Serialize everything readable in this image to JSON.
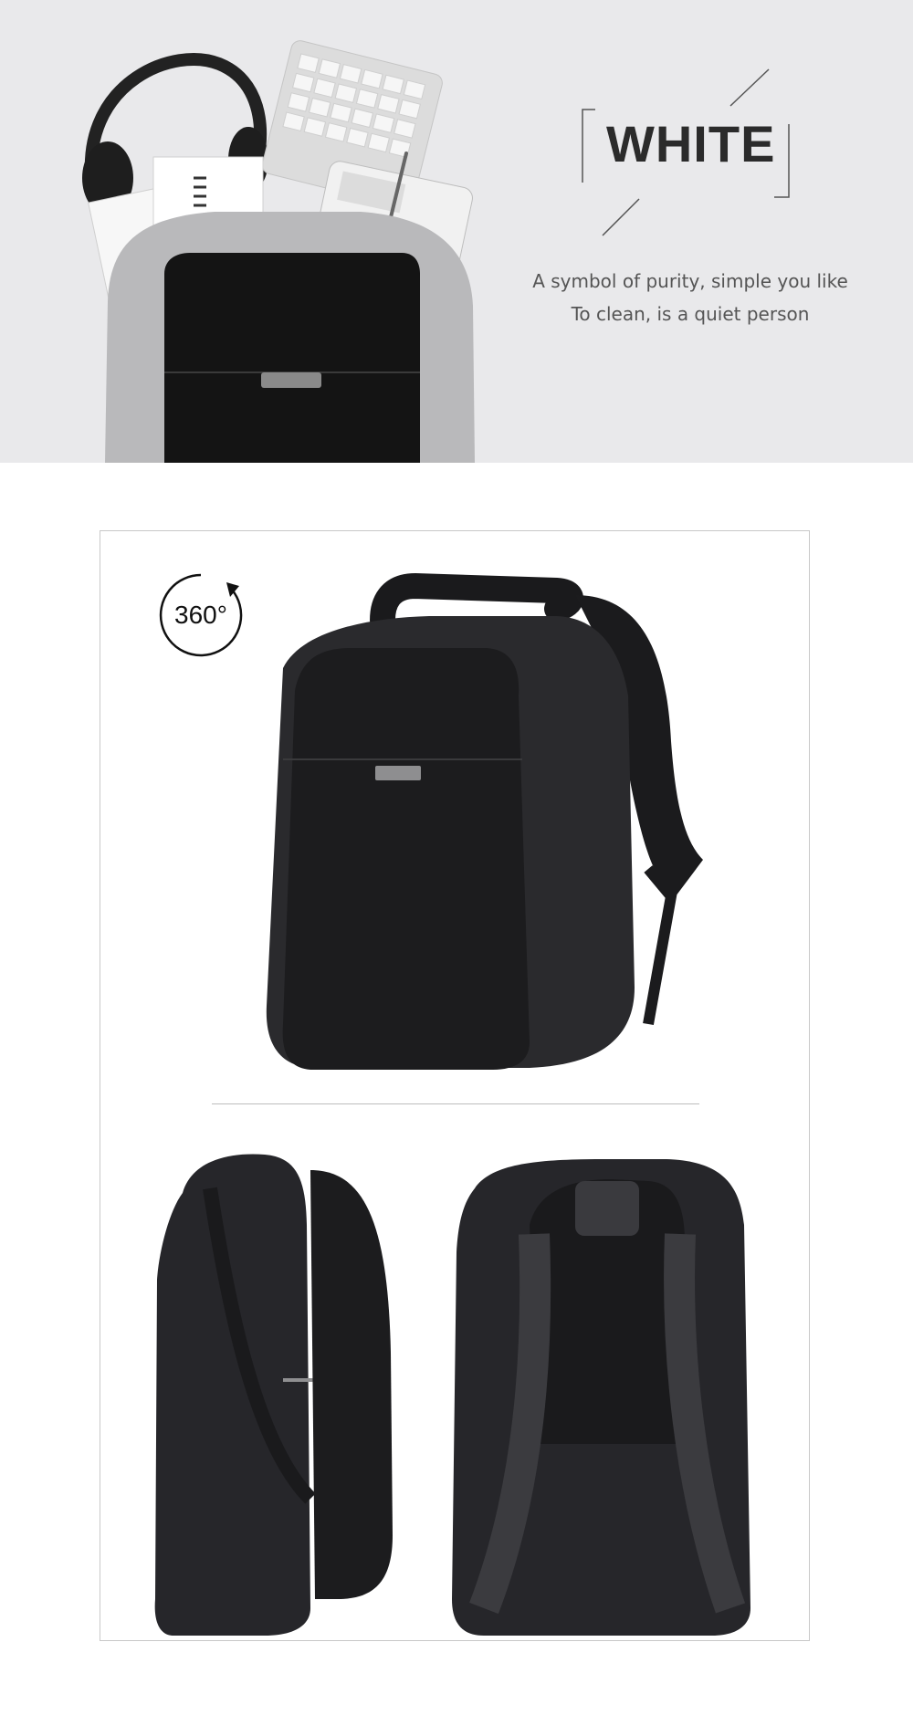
{
  "banner": {
    "headline": "WHITE",
    "tagline_line1": "A symbol of purity, simple you like",
    "tagline_line2": "To clean, is a quiet person"
  },
  "gallery": {
    "badge_label": "360°"
  },
  "colors": {
    "banner_bg": "#e9e9eb",
    "bag_dark": "#1c1c1e",
    "bag_fabric": "#2a2a2d",
    "bag_grey": "#b9b9bb"
  },
  "icons": [
    "rotate-360-icon"
  ]
}
